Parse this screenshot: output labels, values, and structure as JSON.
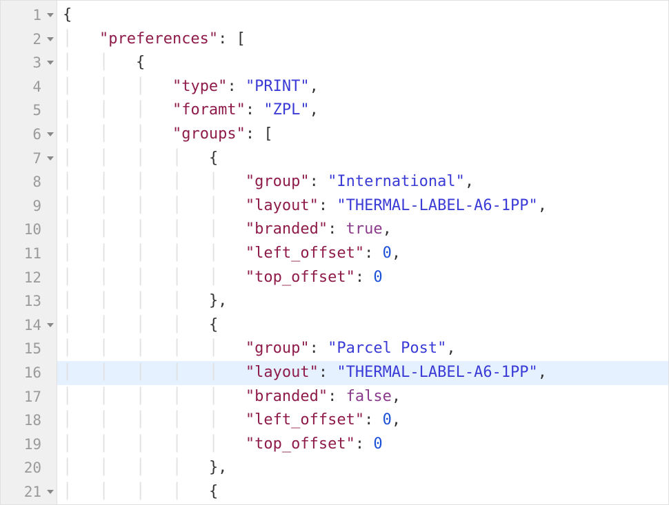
{
  "highlighted_line_index": 15,
  "lines": [
    {
      "num": "1",
      "fold": true,
      "tokens": [
        {
          "t": "{",
          "c": "punc"
        }
      ]
    },
    {
      "num": "2",
      "fold": true,
      "tokens": [
        {
          "t": "    ",
          "c": "guide"
        },
        {
          "t": "\"preferences\"",
          "c": "key"
        },
        {
          "t": ": [",
          "c": "punc"
        }
      ]
    },
    {
      "num": "3",
      "fold": true,
      "tokens": [
        {
          "t": "    ",
          "c": "guide"
        },
        {
          "t": "    ",
          "c": "guide"
        },
        {
          "t": "{",
          "c": "punc"
        }
      ]
    },
    {
      "num": "4",
      "fold": false,
      "tokens": [
        {
          "t": "    ",
          "c": "guide"
        },
        {
          "t": "    ",
          "c": "guide"
        },
        {
          "t": "    ",
          "c": "guide"
        },
        {
          "t": "\"type\"",
          "c": "key"
        },
        {
          "t": ": ",
          "c": "punc"
        },
        {
          "t": "\"PRINT\"",
          "c": "str"
        },
        {
          "t": ",",
          "c": "punc"
        }
      ]
    },
    {
      "num": "5",
      "fold": false,
      "tokens": [
        {
          "t": "    ",
          "c": "guide"
        },
        {
          "t": "    ",
          "c": "guide"
        },
        {
          "t": "    ",
          "c": "guide"
        },
        {
          "t": "\"foramt\"",
          "c": "key"
        },
        {
          "t": ": ",
          "c": "punc"
        },
        {
          "t": "\"ZPL\"",
          "c": "str"
        },
        {
          "t": ",",
          "c": "punc"
        }
      ]
    },
    {
      "num": "6",
      "fold": true,
      "tokens": [
        {
          "t": "    ",
          "c": "guide"
        },
        {
          "t": "    ",
          "c": "guide"
        },
        {
          "t": "    ",
          "c": "guide"
        },
        {
          "t": "\"groups\"",
          "c": "key"
        },
        {
          "t": ": [",
          "c": "punc"
        }
      ]
    },
    {
      "num": "7",
      "fold": true,
      "tokens": [
        {
          "t": "    ",
          "c": "guide"
        },
        {
          "t": "    ",
          "c": "guide"
        },
        {
          "t": "    ",
          "c": "guide"
        },
        {
          "t": "    ",
          "c": "guide"
        },
        {
          "t": "{",
          "c": "punc"
        }
      ]
    },
    {
      "num": "8",
      "fold": false,
      "tokens": [
        {
          "t": "    ",
          "c": "guide"
        },
        {
          "t": "    ",
          "c": "guide"
        },
        {
          "t": "    ",
          "c": "guide"
        },
        {
          "t": "    ",
          "c": "guide"
        },
        {
          "t": "    ",
          "c": "guide"
        },
        {
          "t": "\"group\"",
          "c": "key"
        },
        {
          "t": ": ",
          "c": "punc"
        },
        {
          "t": "\"International\"",
          "c": "str"
        },
        {
          "t": ",",
          "c": "punc"
        }
      ]
    },
    {
      "num": "9",
      "fold": false,
      "tokens": [
        {
          "t": "    ",
          "c": "guide"
        },
        {
          "t": "    ",
          "c": "guide"
        },
        {
          "t": "    ",
          "c": "guide"
        },
        {
          "t": "    ",
          "c": "guide"
        },
        {
          "t": "    ",
          "c": "guide"
        },
        {
          "t": "\"layout\"",
          "c": "key"
        },
        {
          "t": ": ",
          "c": "punc"
        },
        {
          "t": "\"THERMAL-LABEL-A6-1PP\"",
          "c": "str"
        },
        {
          "t": ",",
          "c": "punc"
        }
      ]
    },
    {
      "num": "10",
      "fold": false,
      "tokens": [
        {
          "t": "    ",
          "c": "guide"
        },
        {
          "t": "    ",
          "c": "guide"
        },
        {
          "t": "    ",
          "c": "guide"
        },
        {
          "t": "    ",
          "c": "guide"
        },
        {
          "t": "    ",
          "c": "guide"
        },
        {
          "t": "\"branded\"",
          "c": "key"
        },
        {
          "t": ": ",
          "c": "punc"
        },
        {
          "t": "true",
          "c": "bool"
        },
        {
          "t": ",",
          "c": "punc"
        }
      ]
    },
    {
      "num": "11",
      "fold": false,
      "tokens": [
        {
          "t": "    ",
          "c": "guide"
        },
        {
          "t": "    ",
          "c": "guide"
        },
        {
          "t": "    ",
          "c": "guide"
        },
        {
          "t": "    ",
          "c": "guide"
        },
        {
          "t": "    ",
          "c": "guide"
        },
        {
          "t": "\"left_offset\"",
          "c": "key"
        },
        {
          "t": ": ",
          "c": "punc"
        },
        {
          "t": "0",
          "c": "num"
        },
        {
          "t": ",",
          "c": "punc"
        }
      ]
    },
    {
      "num": "12",
      "fold": false,
      "tokens": [
        {
          "t": "    ",
          "c": "guide"
        },
        {
          "t": "    ",
          "c": "guide"
        },
        {
          "t": "    ",
          "c": "guide"
        },
        {
          "t": "    ",
          "c": "guide"
        },
        {
          "t": "    ",
          "c": "guide"
        },
        {
          "t": "\"top_offset\"",
          "c": "key"
        },
        {
          "t": ": ",
          "c": "punc"
        },
        {
          "t": "0",
          "c": "num"
        }
      ]
    },
    {
      "num": "13",
      "fold": false,
      "tokens": [
        {
          "t": "    ",
          "c": "guide"
        },
        {
          "t": "    ",
          "c": "guide"
        },
        {
          "t": "    ",
          "c": "guide"
        },
        {
          "t": "    ",
          "c": "guide"
        },
        {
          "t": "},",
          "c": "punc"
        }
      ]
    },
    {
      "num": "14",
      "fold": true,
      "tokens": [
        {
          "t": "    ",
          "c": "guide"
        },
        {
          "t": "    ",
          "c": "guide"
        },
        {
          "t": "    ",
          "c": "guide"
        },
        {
          "t": "    ",
          "c": "guide"
        },
        {
          "t": "{",
          "c": "punc"
        }
      ]
    },
    {
      "num": "15",
      "fold": false,
      "tokens": [
        {
          "t": "    ",
          "c": "guide"
        },
        {
          "t": "    ",
          "c": "guide"
        },
        {
          "t": "    ",
          "c": "guide"
        },
        {
          "t": "    ",
          "c": "guide"
        },
        {
          "t": "    ",
          "c": "guide"
        },
        {
          "t": "\"group\"",
          "c": "key"
        },
        {
          "t": ": ",
          "c": "punc"
        },
        {
          "t": "\"Parcel Post\"",
          "c": "str"
        },
        {
          "t": ",",
          "c": "punc"
        }
      ]
    },
    {
      "num": "16",
      "fold": false,
      "tokens": [
        {
          "t": "    ",
          "c": "guide"
        },
        {
          "t": "    ",
          "c": "guide"
        },
        {
          "t": "    ",
          "c": "guide"
        },
        {
          "t": "    ",
          "c": "guide"
        },
        {
          "t": "    ",
          "c": "guide"
        },
        {
          "t": "\"layout\"",
          "c": "key"
        },
        {
          "t": ": ",
          "c": "punc"
        },
        {
          "t": "\"THERMAL-LABEL-A6-1PP\"",
          "c": "str"
        },
        {
          "t": ",",
          "c": "punc"
        }
      ]
    },
    {
      "num": "17",
      "fold": false,
      "tokens": [
        {
          "t": "    ",
          "c": "guide"
        },
        {
          "t": "    ",
          "c": "guide"
        },
        {
          "t": "    ",
          "c": "guide"
        },
        {
          "t": "    ",
          "c": "guide"
        },
        {
          "t": "    ",
          "c": "guide"
        },
        {
          "t": "\"branded\"",
          "c": "key"
        },
        {
          "t": ": ",
          "c": "punc"
        },
        {
          "t": "false",
          "c": "bool"
        },
        {
          "t": ",",
          "c": "punc"
        }
      ]
    },
    {
      "num": "18",
      "fold": false,
      "tokens": [
        {
          "t": "    ",
          "c": "guide"
        },
        {
          "t": "    ",
          "c": "guide"
        },
        {
          "t": "    ",
          "c": "guide"
        },
        {
          "t": "    ",
          "c": "guide"
        },
        {
          "t": "    ",
          "c": "guide"
        },
        {
          "t": "\"left_offset\"",
          "c": "key"
        },
        {
          "t": ": ",
          "c": "punc"
        },
        {
          "t": "0",
          "c": "num"
        },
        {
          "t": ",",
          "c": "punc"
        }
      ]
    },
    {
      "num": "19",
      "fold": false,
      "tokens": [
        {
          "t": "    ",
          "c": "guide"
        },
        {
          "t": "    ",
          "c": "guide"
        },
        {
          "t": "    ",
          "c": "guide"
        },
        {
          "t": "    ",
          "c": "guide"
        },
        {
          "t": "    ",
          "c": "guide"
        },
        {
          "t": "\"top_offset\"",
          "c": "key"
        },
        {
          "t": ": ",
          "c": "punc"
        },
        {
          "t": "0",
          "c": "num"
        }
      ]
    },
    {
      "num": "20",
      "fold": false,
      "tokens": [
        {
          "t": "    ",
          "c": "guide"
        },
        {
          "t": "    ",
          "c": "guide"
        },
        {
          "t": "    ",
          "c": "guide"
        },
        {
          "t": "    ",
          "c": "guide"
        },
        {
          "t": "},",
          "c": "punc"
        }
      ]
    },
    {
      "num": "21",
      "fold": true,
      "tokens": [
        {
          "t": "    ",
          "c": "guide"
        },
        {
          "t": "    ",
          "c": "guide"
        },
        {
          "t": "    ",
          "c": "guide"
        },
        {
          "t": "    ",
          "c": "guide"
        },
        {
          "t": "{",
          "c": "punc"
        }
      ]
    }
  ]
}
